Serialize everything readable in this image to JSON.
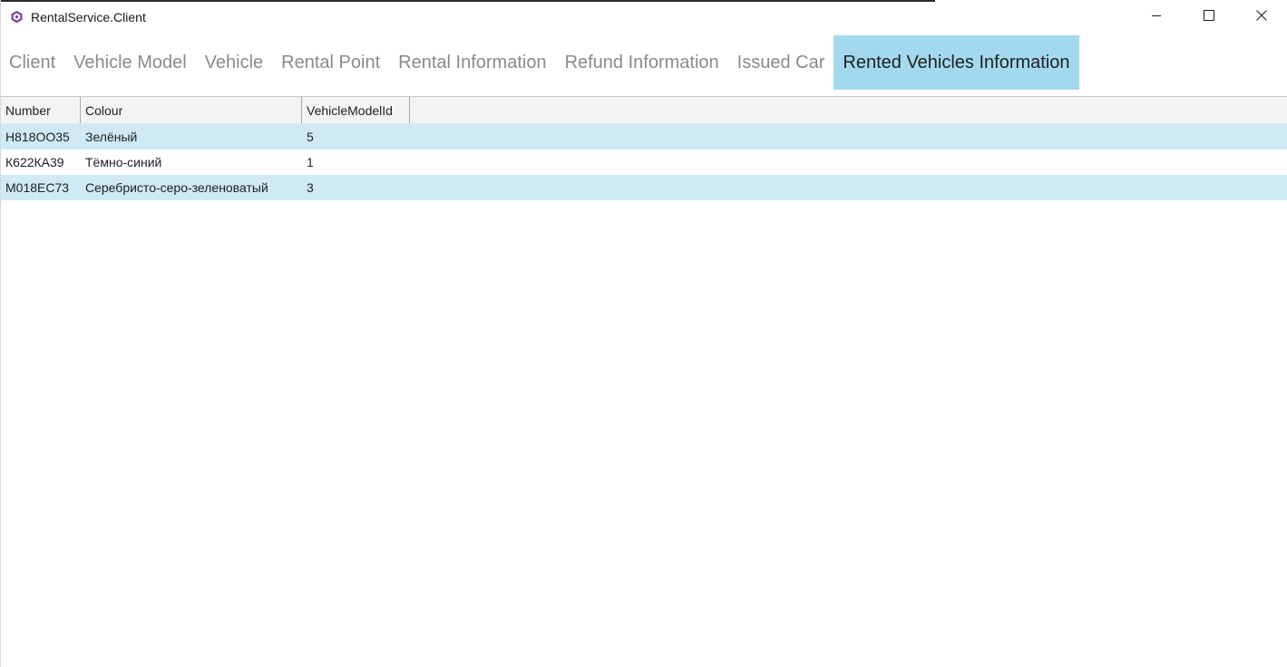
{
  "window": {
    "title": "RentalService.Client",
    "icon": "app-logo-icon",
    "controls": {
      "minimize": "minimize-icon",
      "maximize": "maximize-icon",
      "close": "close-icon"
    }
  },
  "tabs": [
    {
      "label": "Client"
    },
    {
      "label": "Vehicle Model"
    },
    {
      "label": "Vehicle"
    },
    {
      "label": "Rental Point"
    },
    {
      "label": "Rental Information"
    },
    {
      "label": "Refund Information"
    },
    {
      "label": "Issued Car"
    },
    {
      "label": "Rented Vehicles Information"
    }
  ],
  "active_tab": "Rented Vehicles Information",
  "grid": {
    "columns": [
      "Number",
      "Colour",
      "VehicleModelId"
    ],
    "rows": [
      [
        "Н818ОО35",
        "Зелёный",
        "5"
      ],
      [
        "К622КА39",
        "Тёмно-синий",
        "1"
      ],
      [
        "М018ЕС73",
        "Серебристо-серо-зеленоватый",
        "3"
      ]
    ]
  },
  "colors": {
    "active_tab": "#a3d9ef",
    "row_highlight": "#cfeaf6",
    "inactive_tab_text": "#8a8a8a",
    "app_icon": "#7b3fa0"
  }
}
